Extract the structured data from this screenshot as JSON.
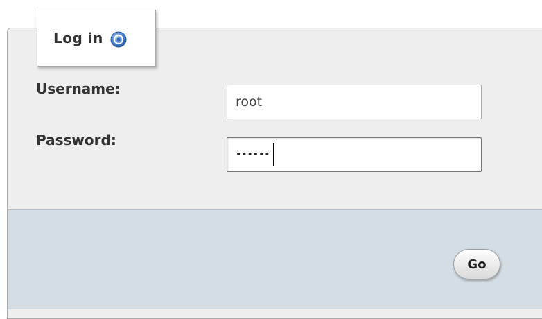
{
  "login": {
    "title": "Log in",
    "help_icon": "help-icon",
    "username_label": "Username:",
    "username_value": "root",
    "password_label": "Password:",
    "password_value": "••••••",
    "submit_label": "Go"
  },
  "colors": {
    "panel_bg": "#eeeeee",
    "footer_bg": "#d4dde4",
    "help_icon_blue": "#3f77c4"
  }
}
